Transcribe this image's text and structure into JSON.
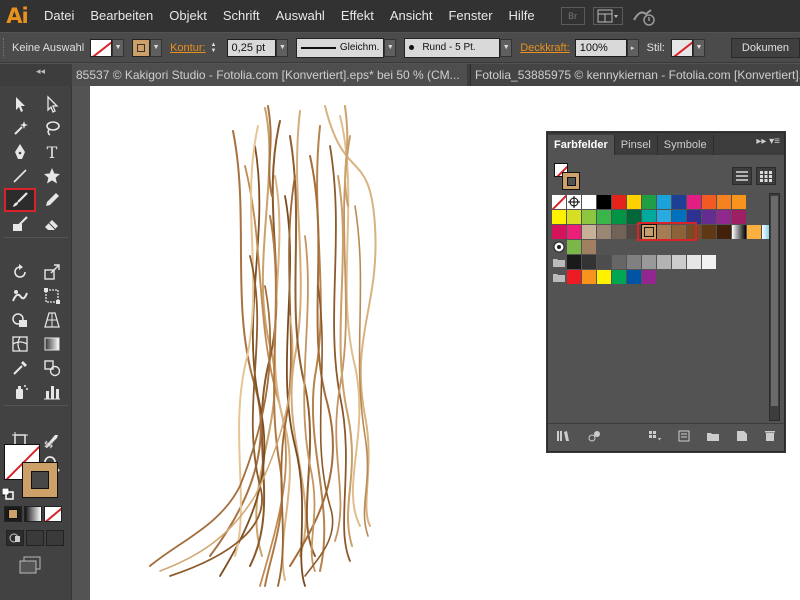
{
  "app": {
    "logo": "Ai"
  },
  "menu": {
    "items": [
      "Datei",
      "Bearbeiten",
      "Objekt",
      "Schrift",
      "Auswahl",
      "Effekt",
      "Ansicht",
      "Fenster",
      "Hilfe"
    ],
    "bridge_label": "Br"
  },
  "control_bar": {
    "selection_label": "Keine Auswahl",
    "stroke_label": "Kontur:",
    "stroke_weight": "0,25 pt",
    "stroke_profile": "Gleichm.",
    "brush": "Rund - 5 Pt.",
    "opacity_label": "Deckkraft:",
    "opacity_value": "100%",
    "style_label": "Stil:",
    "document_button": "Dokumen"
  },
  "tabs": [
    {
      "title": "85537 © Kakigori Studio - Fotolia.com [Konvertiert].eps* bei 50 % (CM...",
      "close": "×"
    },
    {
      "title": "Fotolia_53885975 © kennykiernan - Fotolia.com [Konvertiert]...",
      "close": "×"
    }
  ],
  "tools_panel": {
    "collapse": "◂◂",
    "tools": [
      {
        "name": "selection-tool"
      },
      {
        "name": "direct-selection-tool"
      },
      {
        "name": "magic-wand-tool"
      },
      {
        "name": "lasso-tool"
      },
      {
        "name": "pen-tool"
      },
      {
        "name": "type-tool",
        "glyph": "T"
      },
      {
        "name": "line-tool"
      },
      {
        "name": "star-tool"
      },
      {
        "name": "paintbrush-tool",
        "active": true
      },
      {
        "name": "pencil-tool"
      },
      {
        "name": "blob-brush-tool"
      },
      {
        "name": "eraser-tool"
      },
      {
        "name": "rotate-tool"
      },
      {
        "name": "scale-tool"
      },
      {
        "name": "puppet-warp-tool"
      },
      {
        "name": "free-transform-tool"
      },
      {
        "name": "shape-builder-tool"
      },
      {
        "name": "perspective-grid-tool"
      },
      {
        "name": "mesh-tool"
      },
      {
        "name": "gradient-tool"
      },
      {
        "name": "eyedropper-tool"
      },
      {
        "name": "blend-tool"
      },
      {
        "name": "symbol-sprayer-tool"
      },
      {
        "name": "column-graph-tool"
      },
      {
        "name": "artboard-tool"
      },
      {
        "name": "slice-tool"
      },
      {
        "name": "hand-tool"
      },
      {
        "name": "zoom-tool"
      }
    ]
  },
  "swatches_panel": {
    "tabs": [
      "Farbfelder",
      "Pinsel",
      "Symbole"
    ],
    "active_tab": "Farbfelder",
    "menu_glyphs": "▸▸  ▾≡",
    "colors": {
      "row1": [
        "none",
        "registration",
        "#ffffff",
        "#000000",
        "#e3241b",
        "#ffd100",
        "#1f9e45",
        "#1aa3da",
        "#1d3f94",
        "#e31e82",
        "#f15a22",
        "#f58220",
        "#f7941e"
      ],
      "row2": [
        "#fff200",
        "#d7df23",
        "#8dc63f",
        "#39b54a",
        "#009444",
        "#006838",
        "#00a99d",
        "#29abe2",
        "#0071bc",
        "#2e3192",
        "#662d91",
        "#92278f",
        "#9e1f63"
      ],
      "row3": [
        "#d4145a",
        "#ed1e79",
        "#c7b299",
        "#998675",
        "#736357",
        "#534741",
        "#c69c6d",
        "#a67c52",
        "#8c6239",
        "#754c24",
        "#603813",
        "#42210b",
        "gradient-bw",
        "#fbb040",
        "gradient-blue"
      ],
      "row4": [
        "pattern",
        "#7ab648",
        "#a08060"
      ],
      "row5": [
        "folder",
        "#1a1a1a",
        "#333333",
        "#4d4d4d",
        "#666666",
        "#808080",
        "#999999",
        "#b3b3b3",
        "#cccccc",
        "#e6e6e6",
        "#f2f2f2"
      ],
      "row6": [
        "folder",
        "#ed1c24",
        "#f7941d",
        "#fff200",
        "#00a651",
        "#0054a6",
        "#92278f"
      ]
    }
  }
}
